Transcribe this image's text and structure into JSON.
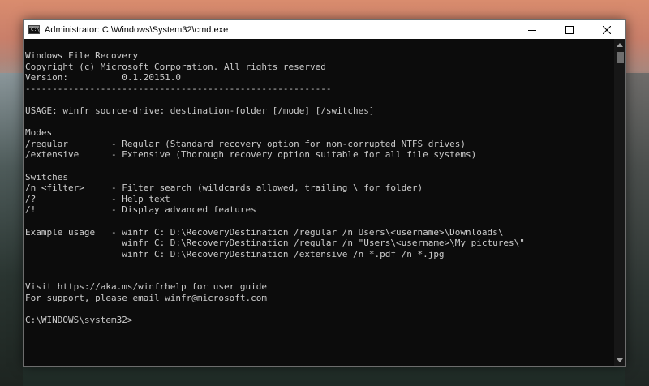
{
  "window": {
    "title": "Administrator: C:\\Windows\\System32\\cmd.exe",
    "app_icon_glyph": "C:\\"
  },
  "caption_buttons": {
    "minimize_icon": "minimize-icon",
    "maximize_icon": "maximize-icon",
    "close_icon": "close-icon"
  },
  "console": {
    "lines": [
      "Windows File Recovery",
      "Copyright (c) Microsoft Corporation. All rights reserved",
      "Version:          0.1.20151.0",
      "---------------------------------------------------------",
      "",
      "USAGE: winfr source-drive: destination-folder [/mode] [/switches]",
      "",
      "Modes",
      "/regular        - Regular (Standard recovery option for non-corrupted NTFS drives)",
      "/extensive      - Extensive (Thorough recovery option suitable for all file systems)",
      "",
      "Switches",
      "/n <filter>     - Filter search (wildcards allowed, trailing \\ for folder)",
      "/?              - Help text",
      "/!              - Display advanced features",
      "",
      "Example usage   - winfr C: D:\\RecoveryDestination /regular /n Users\\<username>\\Downloads\\",
      "                  winfr C: D:\\RecoveryDestination /regular /n \"Users\\<username>\\My pictures\\\"",
      "                  winfr C: D:\\RecoveryDestination /extensive /n *.pdf /n *.jpg",
      "",
      "",
      "Visit https://aka.ms/winfrhelp for user guide",
      "For support, please email winfr@microsoft.com",
      "",
      "C:\\WINDOWS\\system32>"
    ]
  },
  "scrollbar": {
    "up_icon": "scroll-up-arrow-icon",
    "down_icon": "scroll-down-arrow-icon"
  }
}
